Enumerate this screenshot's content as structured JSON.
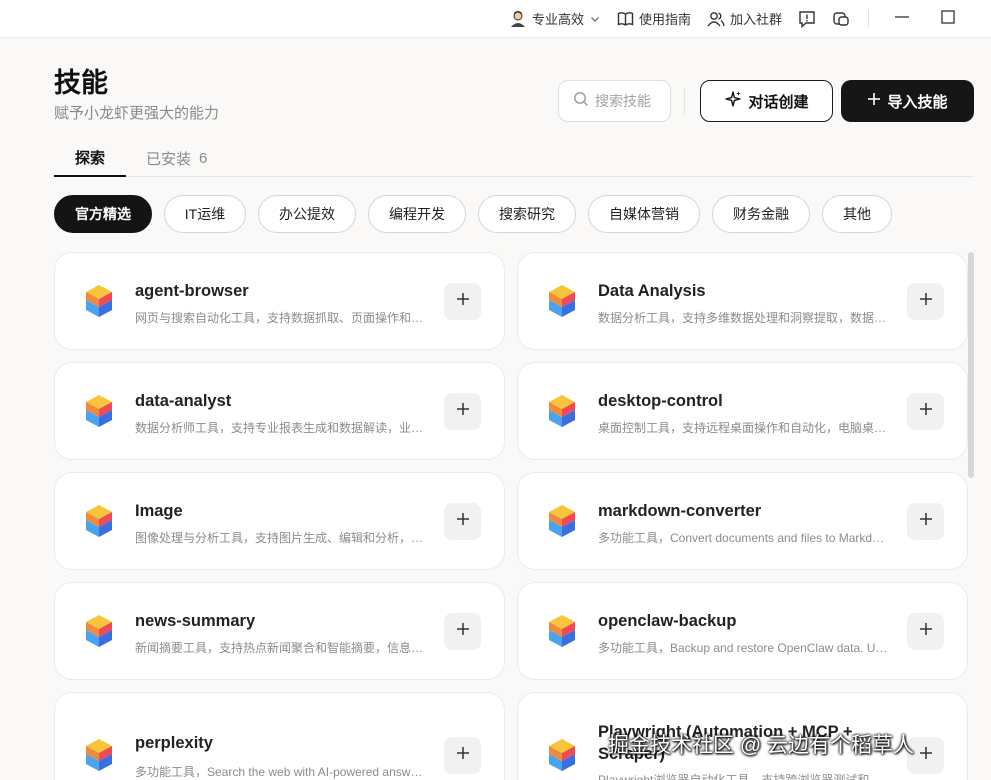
{
  "titlebar": {
    "mode_label": "专业高效",
    "guide_label": "使用指南",
    "community_label": "加入社群"
  },
  "header": {
    "title": "技能",
    "subtitle": "赋予小龙虾更强大的能力",
    "search_placeholder": "搜索技能",
    "chat_create_label": "对话创建",
    "import_label": "导入技能"
  },
  "tabs": {
    "explore_label": "探索",
    "installed_label": "已安装",
    "installed_count": "6"
  },
  "categories": [
    "官方精选",
    "IT运维",
    "办公提效",
    "编程开发",
    "搜索研究",
    "自媒体营销",
    "财务金融",
    "其他"
  ],
  "skills": [
    {
      "name": "agent-browser",
      "desc": "网页与搜索自动化工具，支持数据抓取、页面操作和自动化流程"
    },
    {
      "name": "Data Analysis",
      "desc": "数据分析工具，支持多维数据处理和洞察提取，数据可视化"
    },
    {
      "name": "data-analyst",
      "desc": "数据分析师工具，支持专业报表生成和数据解读，业务分析"
    },
    {
      "name": "desktop-control",
      "desc": "桌面控制工具，支持远程桌面操作和自动化，电脑桌面管理"
    },
    {
      "name": "Image",
      "desc": "图像处理与分析工具，支持图片生成、编辑和分析，图像识别"
    },
    {
      "name": "markdown-converter",
      "desc": "多功能工具，Convert documents and files to Markdown"
    },
    {
      "name": "news-summary",
      "desc": "新闻摘要工具，支持热点新闻聚合和智能摘要，信息追踪"
    },
    {
      "name": "openclaw-backup",
      "desc": "多功能工具，Backup and restore OpenClaw data. Use"
    },
    {
      "name": "perplexity",
      "desc": "多功能工具，Search the web with AI-powered answers"
    },
    {
      "name": "Playwright (Automation + MCP + Scraper)",
      "desc": "Playwright浏览器自动化工具，支持跨浏览器测试和"
    }
  ],
  "watermark": "掘金技术社区 @ 云边有个稻草人",
  "colors": {
    "accent_dark": "#141414",
    "page_bg": "#faf9f7"
  }
}
